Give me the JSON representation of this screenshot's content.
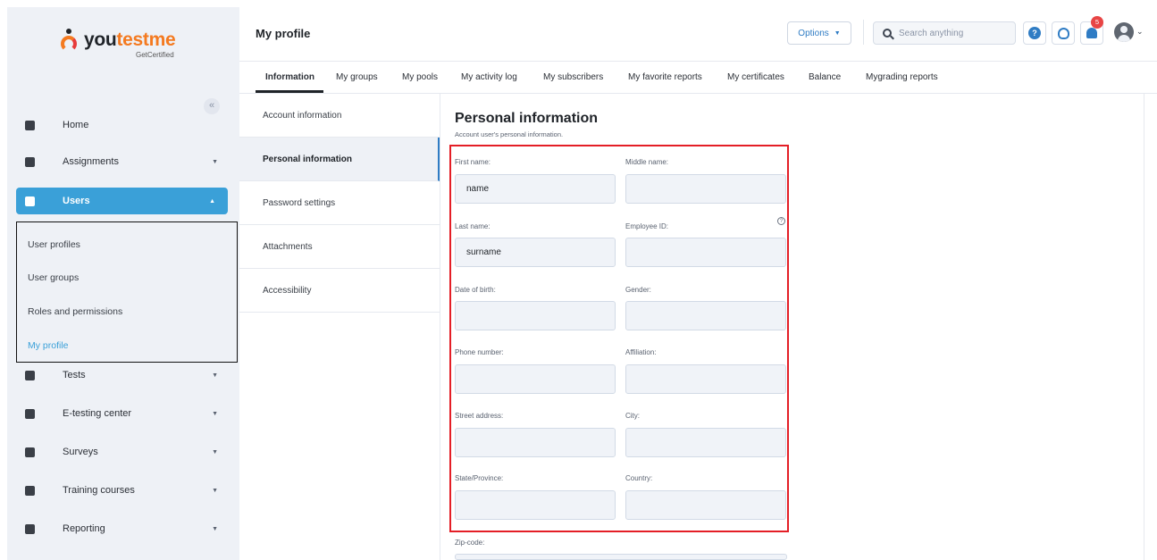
{
  "brand": {
    "name_part1": "you",
    "name_part2": "testme",
    "tagline": "GetCertified"
  },
  "sidebar": {
    "collapse_glyph": "«",
    "items": [
      {
        "label": "Home",
        "icon": "home-icon"
      },
      {
        "label": "Assignments",
        "icon": "assignments-icon"
      },
      {
        "label": "Users",
        "icon": "users-icon"
      },
      {
        "label": "Tests",
        "icon": "tests-icon"
      },
      {
        "label": "E-testing center",
        "icon": "e-testing-icon"
      },
      {
        "label": "Surveys",
        "icon": "surveys-icon"
      },
      {
        "label": "Training courses",
        "icon": "trophy-icon"
      },
      {
        "label": "Reporting",
        "icon": "reporting-icon"
      }
    ],
    "users_submenu": [
      {
        "label": "User profiles"
      },
      {
        "label": "User groups"
      },
      {
        "label": "Roles and permissions"
      },
      {
        "label": "My profile"
      }
    ]
  },
  "header": {
    "title": "My profile",
    "options_label": "Options",
    "search_placeholder": "Search anything",
    "notification_count": "5"
  },
  "tabs": [
    {
      "label": "Information"
    },
    {
      "label": "My groups"
    },
    {
      "label": "My pools"
    },
    {
      "label": "My activity log"
    },
    {
      "label": "My subscribers"
    },
    {
      "label": "My favorite reports"
    },
    {
      "label": "My certificates"
    },
    {
      "label": "Balance"
    },
    {
      "label": "Mygrading reports"
    }
  ],
  "sections": [
    {
      "label": "Account information"
    },
    {
      "label": "Personal information"
    },
    {
      "label": "Password settings"
    },
    {
      "label": "Attachments"
    },
    {
      "label": "Accessibility"
    }
  ],
  "form": {
    "title": "Personal information",
    "subtitle": "Account user's personal information.",
    "fields": {
      "first_name": {
        "label": "First name:",
        "value": "name"
      },
      "middle_name": {
        "label": "Middle name:",
        "value": ""
      },
      "last_name": {
        "label": "Last name:",
        "value": "surname"
      },
      "employee_id": {
        "label": "Employee ID:",
        "value": ""
      },
      "dob": {
        "label": "Date of birth:",
        "value": ""
      },
      "gender": {
        "label": "Gender:",
        "value": ""
      },
      "phone": {
        "label": "Phone number:",
        "value": ""
      },
      "affiliation": {
        "label": "Affiliation:",
        "value": ""
      },
      "street": {
        "label": "Street address:",
        "value": ""
      },
      "city": {
        "label": "City:",
        "value": ""
      },
      "state": {
        "label": "State/Province:",
        "value": ""
      },
      "country": {
        "label": "Country:",
        "value": ""
      },
      "zip": {
        "label": "Zip-code:",
        "value": ""
      }
    }
  }
}
